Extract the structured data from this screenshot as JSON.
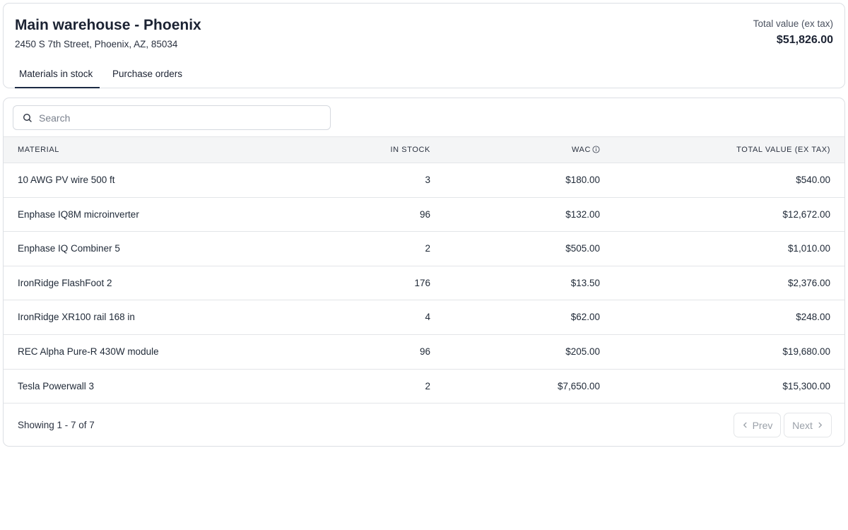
{
  "warehouse": {
    "title": "Main warehouse - Phoenix",
    "address": "2450 S 7th Street, Phoenix, AZ, 85034",
    "total_label": "Total value (ex tax)",
    "total_value": "$51,826.00"
  },
  "tabs": [
    {
      "label": "Materials in stock",
      "active": true
    },
    {
      "label": "Purchase orders",
      "active": false
    }
  ],
  "search": {
    "placeholder": "Search",
    "value": ""
  },
  "table": {
    "headers": {
      "material": "MATERIAL",
      "in_stock": "IN STOCK",
      "wac": "WAC",
      "total_value": "TOTAL VALUE (EX TAX)"
    },
    "rows": [
      {
        "material": "10 AWG PV wire 500 ft",
        "in_stock": "3",
        "wac": "$180.00",
        "total_value": "$540.00"
      },
      {
        "material": "Enphase IQ8M microinverter",
        "in_stock": "96",
        "wac": "$132.00",
        "total_value": "$12,672.00"
      },
      {
        "material": "Enphase IQ Combiner 5",
        "in_stock": "2",
        "wac": "$505.00",
        "total_value": "$1,010.00"
      },
      {
        "material": "IronRidge FlashFoot 2",
        "in_stock": "176",
        "wac": "$13.50",
        "total_value": "$2,376.00"
      },
      {
        "material": "IronRidge XR100 rail 168 in",
        "in_stock": "4",
        "wac": "$62.00",
        "total_value": "$248.00"
      },
      {
        "material": "REC Alpha Pure-R 430W module",
        "in_stock": "96",
        "wac": "$205.00",
        "total_value": "$19,680.00"
      },
      {
        "material": "Tesla Powerwall 3",
        "in_stock": "2",
        "wac": "$7,650.00",
        "total_value": "$15,300.00"
      }
    ]
  },
  "pagination": {
    "showing": "Showing 1 - 7 of 7",
    "prev_label": "Prev",
    "next_label": "Next"
  }
}
